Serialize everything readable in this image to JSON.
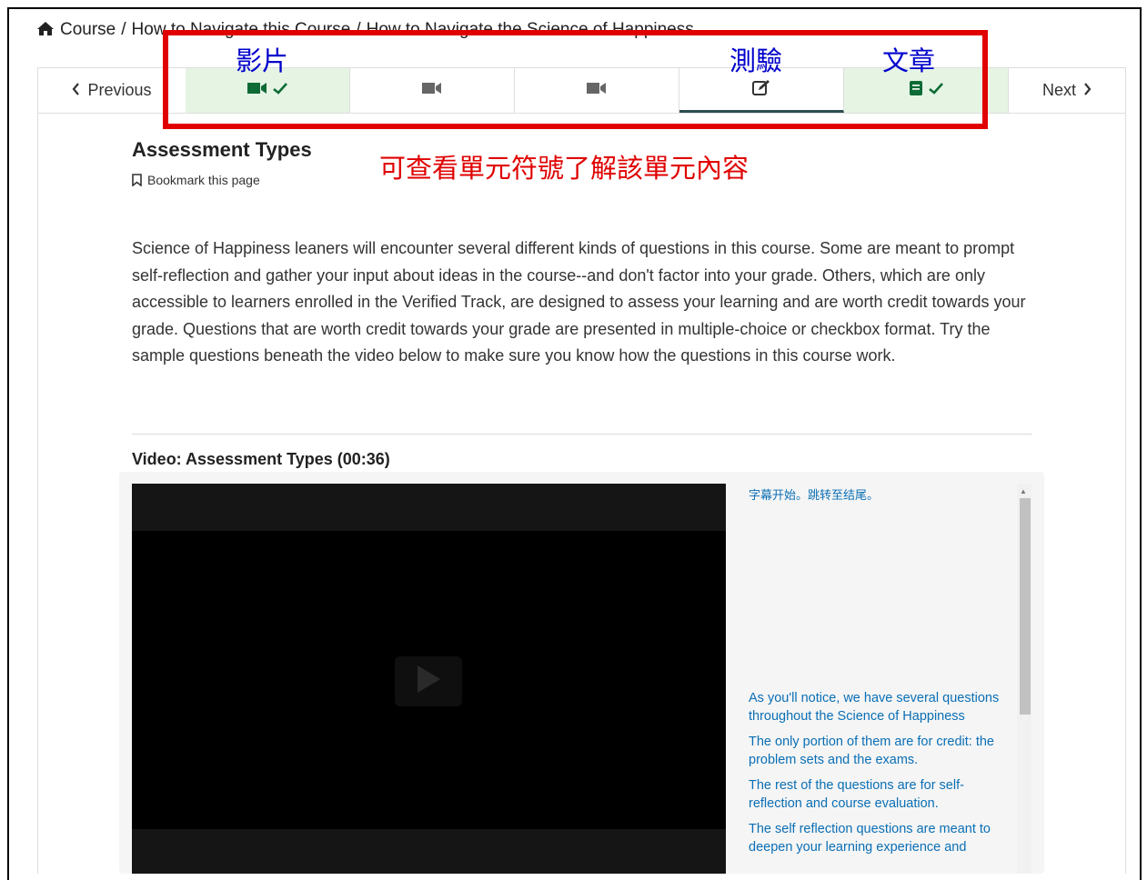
{
  "breadcrumb": {
    "course": "Course",
    "sep": "/",
    "section": "How to Navigate this Course",
    "subsection": "How to Navigate the Science of Happiness"
  },
  "sequence_nav": {
    "previous_label": "Previous",
    "next_label": "Next",
    "units": [
      {
        "type": "video-icon",
        "completed": true
      },
      {
        "type": "video-icon",
        "completed": false
      },
      {
        "type": "video-icon",
        "completed": false
      },
      {
        "type": "problem-icon",
        "completed": false,
        "active": true
      },
      {
        "type": "article-icon",
        "completed": true
      }
    ]
  },
  "annotations": {
    "video": "影片",
    "quiz": "測驗",
    "article": "文章",
    "hint": "可查看單元符號了解該單元內容",
    "colors": {
      "box": "#e00000",
      "labels": "#0000cc"
    }
  },
  "unit": {
    "title": "Assessment Types",
    "bookmark_label": "Bookmark this page",
    "body": "Science of Happiness leaners will encounter several different kinds of questions in this course. Some are meant to prompt self-reflection and gather your input about ideas in the course--and don't factor into your grade. Others, which are only accessible to learners enrolled in the Verified Track, are designed to assess your learning and are worth credit towards your grade. Questions that are worth credit towards your grade are presented in multiple-choice or checkbox format. Try the sample questions beneath the video below to make sure you know how the questions in this course work."
  },
  "video": {
    "heading": "Video: Assessment Types (00:36)",
    "transcript_skip": "字幕开始。跳转至结尾。",
    "transcript_lines": [
      "As you'll notice, we have several questions throughout the Science of Happiness",
      "The only portion of them are for credit: the problem sets and the exams.",
      "The rest of the questions are for self-reflection and course evaluation.",
      "The self reflection questions are meant to deepen your learning experience and"
    ]
  }
}
